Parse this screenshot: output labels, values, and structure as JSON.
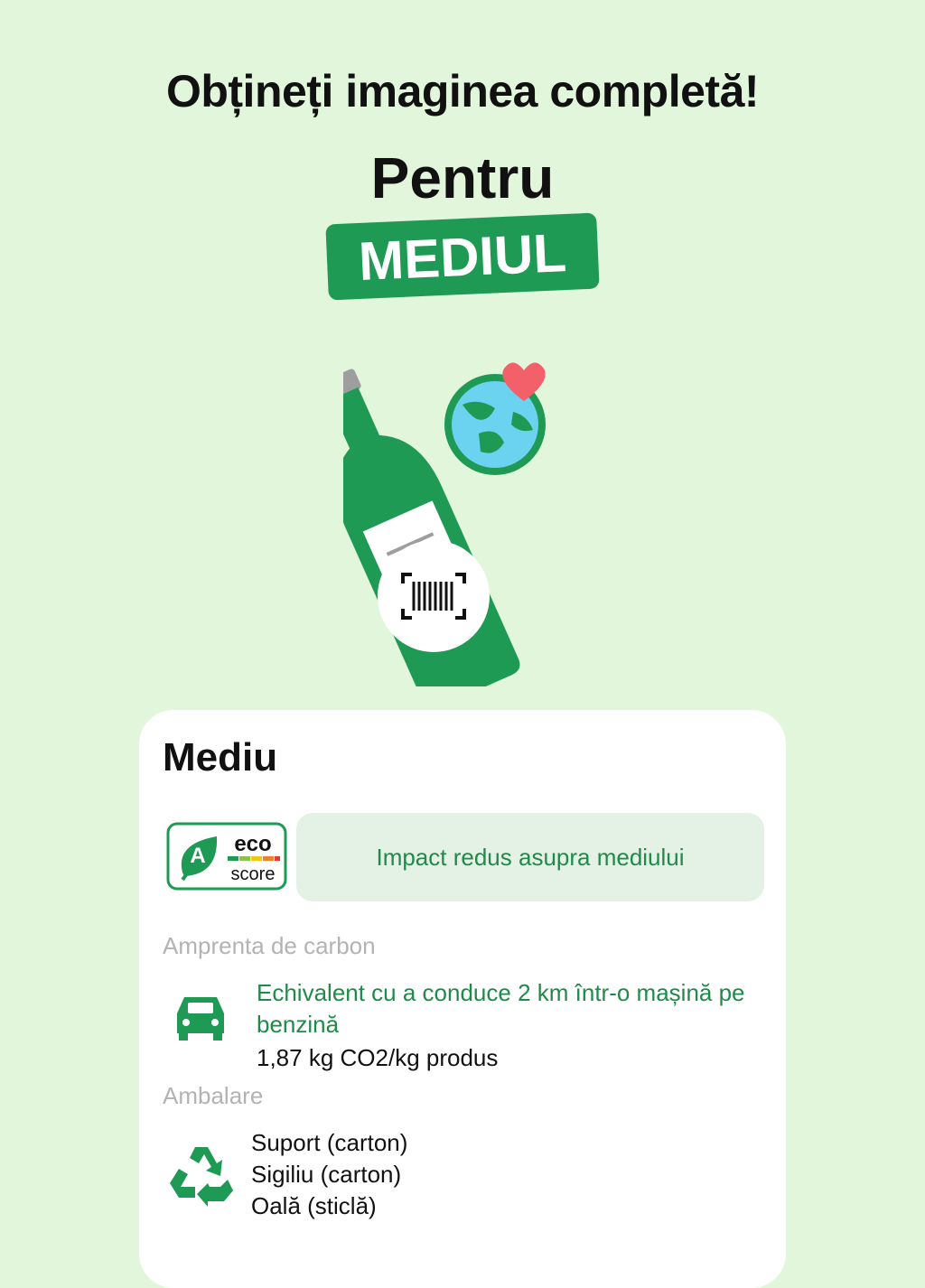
{
  "header": {
    "headline": "Obțineți imaginea completă!",
    "subheadline": "Pentru",
    "highlight": "MEDIUL"
  },
  "illustration": {
    "icons": [
      "bottle-icon",
      "globe-icon",
      "heart-icon",
      "barcode-scan-icon"
    ]
  },
  "card": {
    "title": "Mediu",
    "eco_score": {
      "grade": "A",
      "logo_text_top": "eco",
      "logo_text_bottom": "score",
      "impact_text": "Impact redus asupra mediului"
    },
    "carbon": {
      "label": "Amprenta de carbon",
      "icon": "car-icon",
      "description": "Echivalent cu a conduce 2 km într-o mașină pe benzină",
      "value": "1,87 kg CO2/kg produs"
    },
    "packaging": {
      "label": "Ambalare",
      "icon": "recycle-icon",
      "items": [
        "Suport (carton)",
        "Sigiliu (carton)",
        "Oală (sticlă)"
      ]
    }
  },
  "colors": {
    "background": "#e2f6dc",
    "brand_green": "#1f9a55",
    "text_green": "#1f8a4a",
    "impact_bg": "#e4f2e5",
    "globe_blue": "#6bd3ef",
    "heart_red": "#f4606a"
  }
}
